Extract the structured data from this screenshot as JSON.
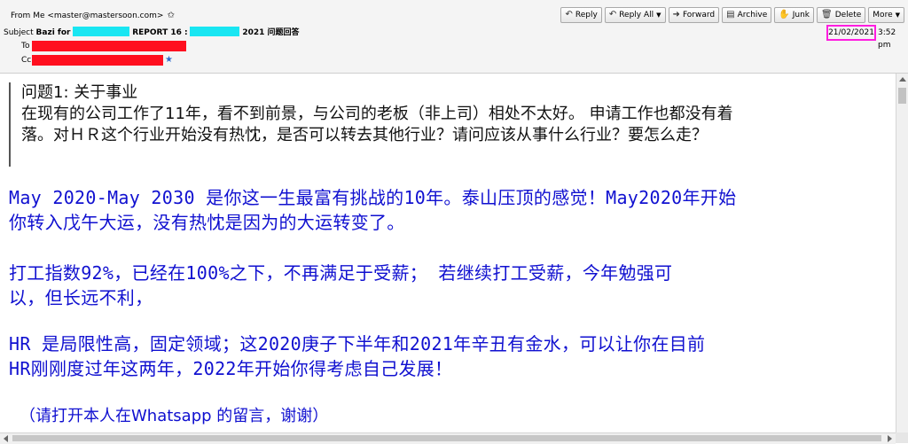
{
  "header": {
    "from_label": "From",
    "from_value": "Me <master@mastersoon.com>",
    "subject_label": "Subject",
    "subject_part1": "Bazi for",
    "subject_part2": "REPORT 16 :",
    "subject_part3": "2021 问题回答",
    "to_label": "To",
    "cc_label": "Cc",
    "date": "21/02/2021",
    "time": "3:52 pm"
  },
  "toolbar": {
    "reply": "Reply",
    "reply_all": "Reply All",
    "forward": "Forward",
    "archive": "Archive",
    "junk": "Junk",
    "delete": "Delete",
    "more": "More"
  },
  "message": {
    "question_title": "问题1: 关于事业",
    "question_line1": "在现有的公司工作了11年，看不到前景，与公司的老板（非上司）相处不太好。 申请工作也都没有着",
    "question_line2": "落。对ＨＲ这个行业开始没有热忱，是否可以转去其他行业？请问应该从事什么行业？要怎么走？",
    "para1_line1": "May 2020-May 2030 是你这一生最富有挑战的10年。泰山压顶的感觉！May2020年开始",
    "para1_line2": "你转入戊午大运，没有热忱是因为的大运转变了。",
    "para2_line1": "打工指数92%，已经在100%之下，不再满足于受薪； 若继续打工受薪，今年勉强可",
    "para2_line2": "以，但长远不利，",
    "para3_line1": "HR 是局限性高，固定领域；这2020庚子下半年和2021年辛丑有金水，可以让你在目前",
    "para3_line2": "HR刚刚度过年这两年，2022年开始你得考虑自己发展！",
    "note": "（请打开本人在Whatsapp 的留言，谢谢）"
  },
  "colors": {
    "redaction_cyan": "#19e6f2",
    "redaction_red": "#ff0f1f",
    "date_highlight": "#ff1de0",
    "answer_text": "#1010d0"
  }
}
